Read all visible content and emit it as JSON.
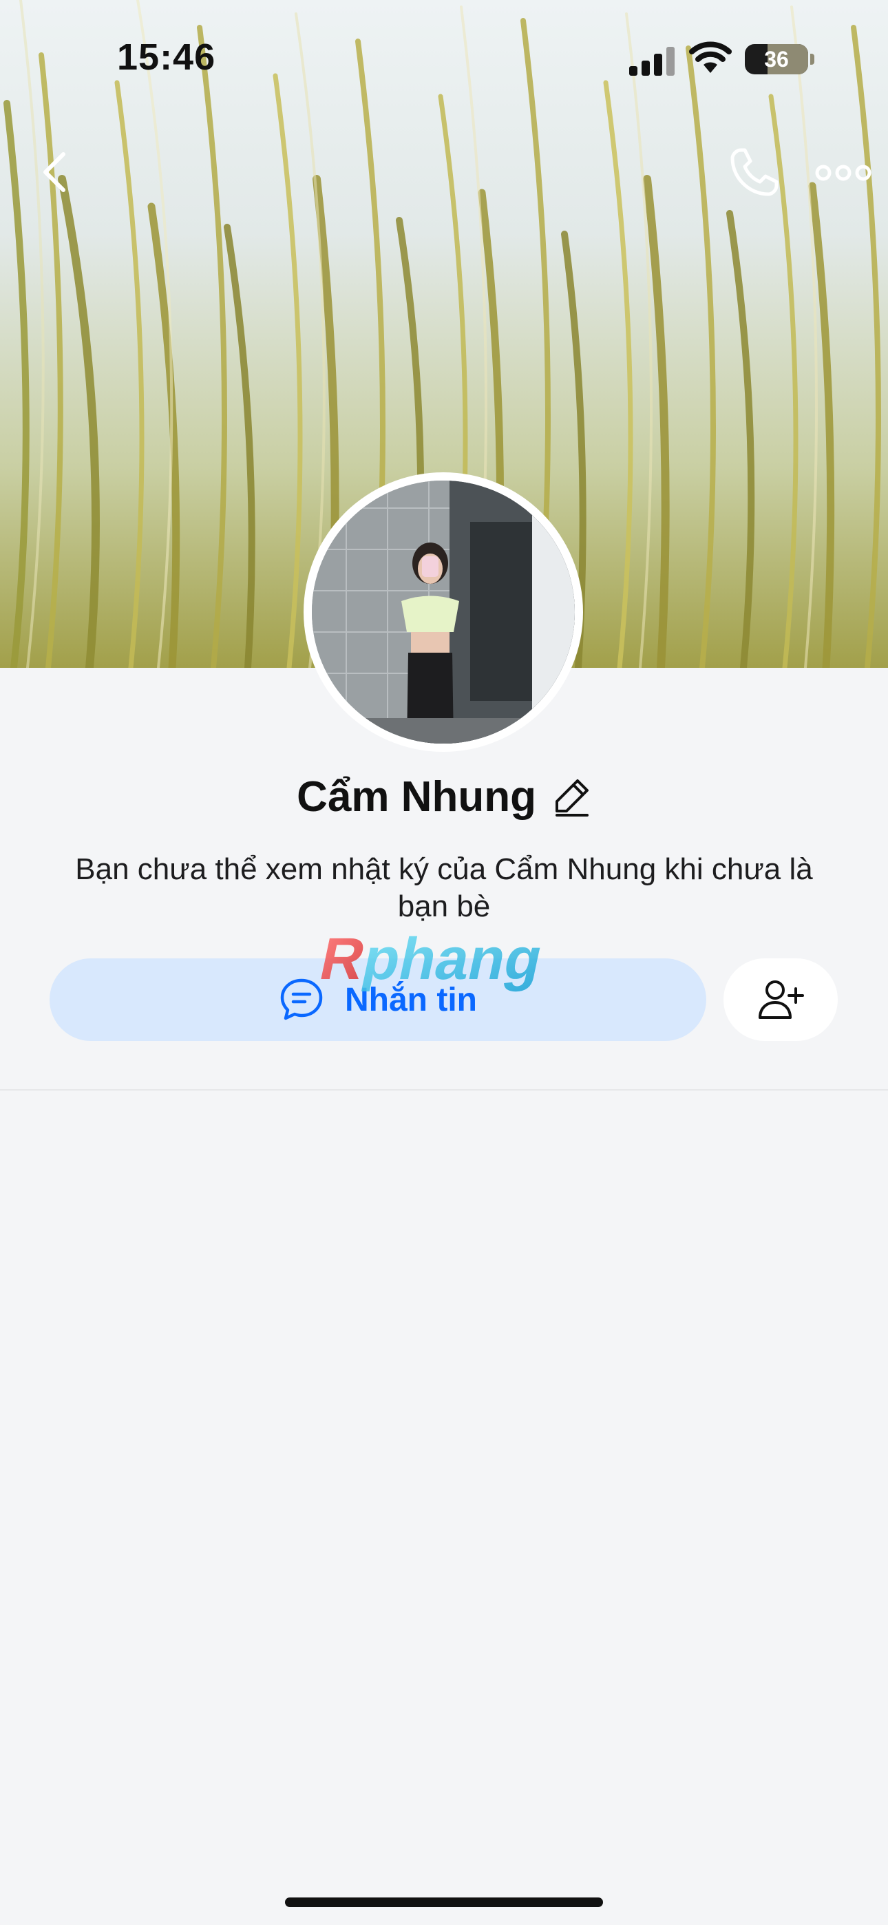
{
  "status_bar": {
    "time": "15:46",
    "battery": 36,
    "signal_icon": "cellular-signal-icon",
    "wifi_icon": "wifi-icon"
  },
  "nav": {
    "back_icon": "chevron-left-icon",
    "call_icon": "phone-icon",
    "more_icon": "more-horizontal-icon"
  },
  "profile": {
    "name": "Cẩm Nhung",
    "edit_icon": "pencil-icon",
    "notice": "Bạn chưa thể xem nhật ký của Cẩm Nhung khi chưa là bạn bè"
  },
  "actions": {
    "message_label": "Nhắn tin",
    "message_icon": "chat-bubble-icon",
    "add_friend_icon": "add-user-icon"
  },
  "watermark": {
    "text": "Rphang"
  },
  "colors": {
    "accent": "#0a68ff",
    "message_button_bg": "#d8e8fd",
    "page_bg": "#f4f5f7"
  }
}
